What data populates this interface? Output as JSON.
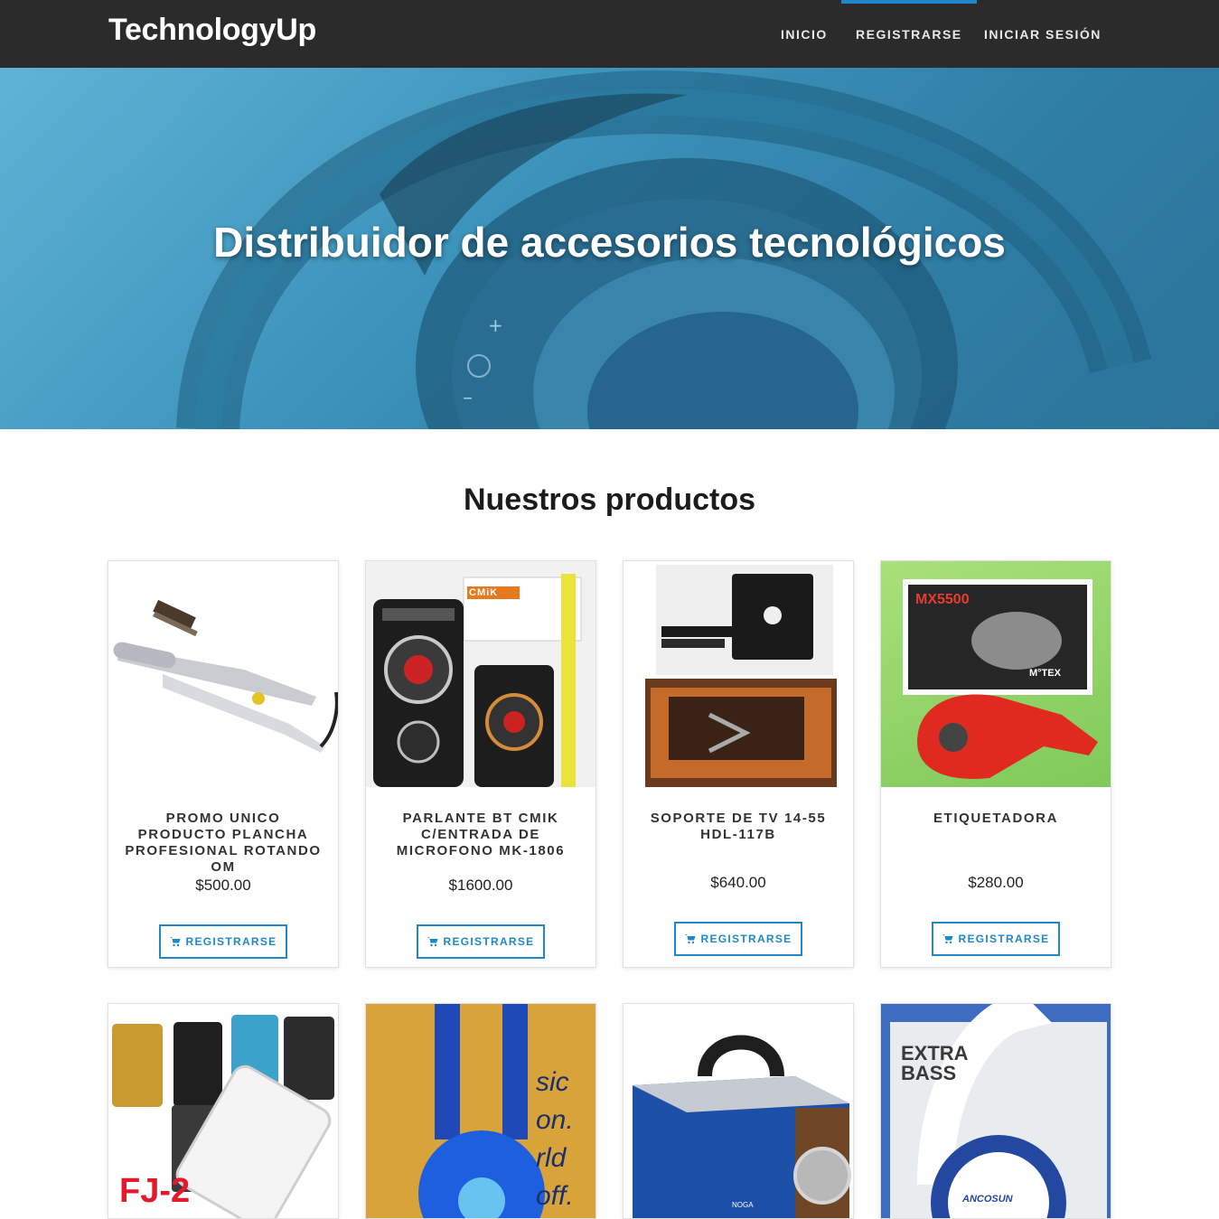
{
  "navbar": {
    "brand": "TechnologyUp",
    "items": [
      {
        "label": "INICIO",
        "active": false
      },
      {
        "label": "REGISTRARSE",
        "active": true
      },
      {
        "label": "INICIAR SESIÓN",
        "active": false
      }
    ],
    "accent_color": "#1e88c8"
  },
  "hero": {
    "title": "Distribuidor de accesorios tecnológicos",
    "image_icon": "headphones-photo"
  },
  "products": {
    "heading": "Nuestros productos",
    "items": [
      {
        "name": "PROMO UNICO PRODUCTO PLANCHA PROFESIONAL ROTANDO OM",
        "price": "$500.00",
        "button": "REGISTRARSE"
      },
      {
        "name": "PARLANTE BT CMIK C/ENTRADA DE MICROFONO MK-1806",
        "price": "$1600.00",
        "button": "REGISTRARSE",
        "image_text": "CMiK"
      },
      {
        "name": "SOPORTE DE TV 14-55 HDL-117B",
        "price": "$640.00",
        "button": "REGISTRARSE"
      },
      {
        "name": "ETIQUETADORA",
        "price": "$280.00",
        "button": "REGISTRARSE",
        "image_text": "MX5500",
        "image_text_2": "M°TEX"
      },
      {
        "image_text": "FJ-2"
      },
      {
        "image_text": "sic on. rld off."
      },
      {
        "image_text": "NOGA"
      },
      {
        "image_text": "EXTRA BASS",
        "image_text_2": "ANCOSUN"
      }
    ]
  }
}
